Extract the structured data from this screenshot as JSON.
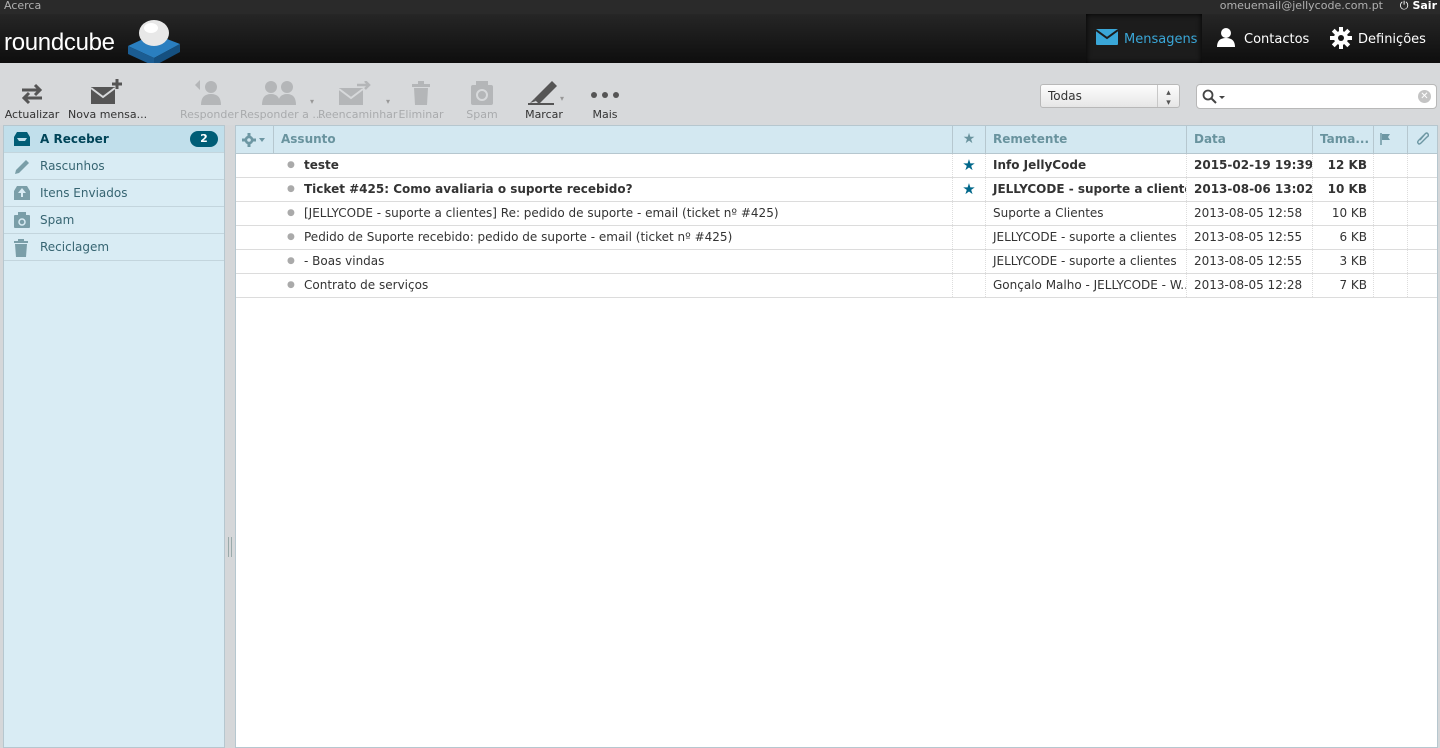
{
  "topline": {
    "about": "Acerca",
    "user": "omeuemail@jellycode.com.pt",
    "logout": "Sair"
  },
  "header": {
    "logo_text": "roundcube",
    "nav": [
      {
        "label": "Mensagens",
        "icon": "envelope-icon",
        "active": true
      },
      {
        "label": "Contactos",
        "icon": "person-icon"
      },
      {
        "label": "Definições",
        "icon": "gear-icon"
      }
    ]
  },
  "toolbar": {
    "refresh": "Actualizar",
    "compose": "Nova mensa...",
    "reply": "Responder",
    "reply_all": "Responder a ...",
    "forward": "Reencaminhar",
    "delete": "Eliminar",
    "spam": "Spam",
    "mark": "Marcar",
    "more": "Mais",
    "filter_value": "Todas",
    "search_value": ""
  },
  "folders": [
    {
      "name": "A Receber",
      "icon": "inbox-icon",
      "unread": "2",
      "selected": true
    },
    {
      "name": "Rascunhos",
      "icon": "pencil-icon"
    },
    {
      "name": "Itens Enviados",
      "icon": "sent-icon"
    },
    {
      "name": "Spam",
      "icon": "spam-icon"
    },
    {
      "name": "Reciclagem",
      "icon": "trash-icon"
    }
  ],
  "list_header": {
    "subject": "Assunto",
    "flag_star": "★",
    "from": "Remetente",
    "date": "Data",
    "size": "Tama..."
  },
  "messages": [
    {
      "subject": "teste",
      "star": "★",
      "from": "Info JellyCode",
      "date": "2015-02-19 19:39",
      "size": "12 KB",
      "unread": true
    },
    {
      "subject": "Ticket #425: Como avaliaria o suporte recebido?",
      "star": "★",
      "from": "JELLYCODE - suporte a clientes",
      "date": "2013-08-06 13:02",
      "size": "10 KB",
      "unread": true
    },
    {
      "subject": "[JELLYCODE - suporte a clientes] Re: pedido de suporte - email (ticket nº #425)",
      "star": "",
      "from": "Suporte a Clientes",
      "date": "2013-08-05 12:58",
      "size": "10 KB",
      "unread": false
    },
    {
      "subject": "Pedido de Suporte recebido: pedido de suporte - email (ticket nº #425)",
      "star": "",
      "from": "JELLYCODE - suporte a clientes",
      "date": "2013-08-05 12:55",
      "size": "6 KB",
      "unread": false
    },
    {
      "subject": "- Boas vindas",
      "star": "",
      "from": "JELLYCODE - suporte a clientes",
      "date": "2013-08-05 12:55",
      "size": "3 KB",
      "unread": false
    },
    {
      "subject": "Contrato de serviços",
      "star": "",
      "from": "Gonçalo Malho - JELLYCODE - W...",
      "date": "2013-08-05 12:28",
      "size": "7 KB",
      "unread": false
    }
  ],
  "colors": {
    "accent": "#3aa7d8",
    "badge": "#005d76",
    "star": "#00678a",
    "folder_bg": "#d9ecf4"
  }
}
